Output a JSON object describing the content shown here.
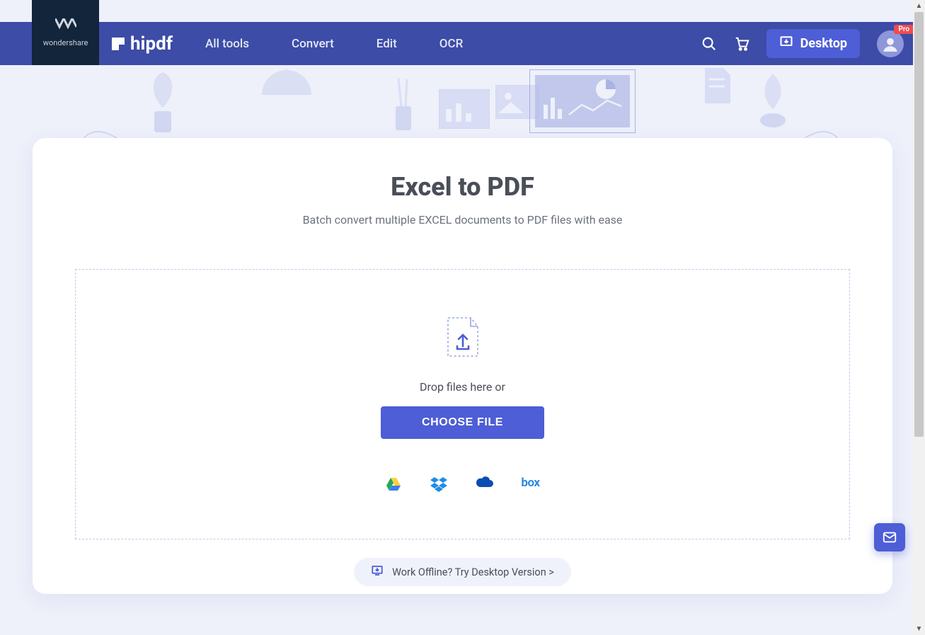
{
  "brand": {
    "company": "wondershare"
  },
  "nav": {
    "logo_text": "hipdf",
    "menu": {
      "all_tools": "All tools",
      "convert": "Convert",
      "edit": "Edit",
      "ocr": "OCR"
    },
    "desktop_label": "Desktop",
    "pro_badge": "Pro"
  },
  "page": {
    "title": "Excel to PDF",
    "subtitle": "Batch convert multiple EXCEL documents to PDF files with ease"
  },
  "dropzone": {
    "drop_text": "Drop files here or",
    "choose_label": "CHOOSE FILE"
  },
  "cloud": {
    "box_text": "box"
  },
  "offline": {
    "text": "Work Offline? Try Desktop Version >"
  }
}
